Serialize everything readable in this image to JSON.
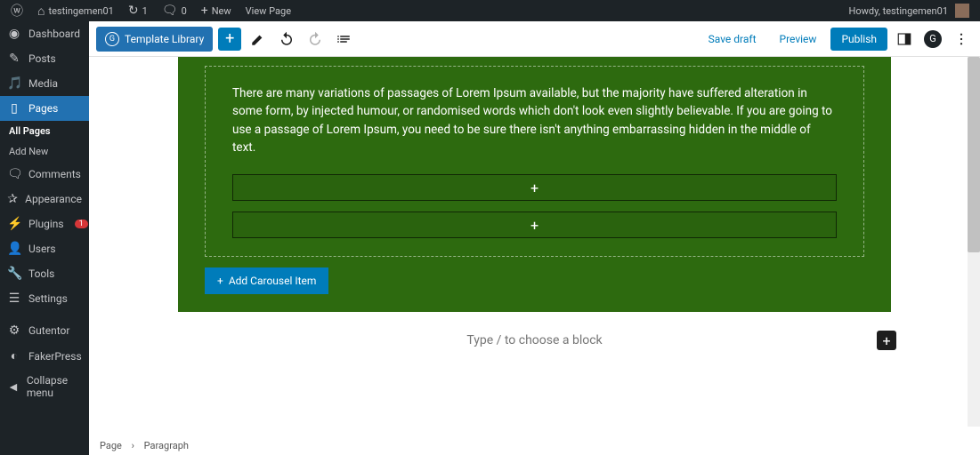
{
  "adminbar": {
    "site_name": "testingemen01",
    "refresh_count": "1",
    "comments_count": "0",
    "new_label": "New",
    "view_page": "View Page",
    "howdy": "Howdy, testingemen01"
  },
  "sidebar": {
    "items": [
      {
        "icon": "dash",
        "label": "Dashboard"
      },
      {
        "icon": "pin",
        "label": "Posts"
      },
      {
        "icon": "media",
        "label": "Media"
      },
      {
        "icon": "page",
        "label": "Pages",
        "current": true
      },
      {
        "icon": "comment",
        "label": "Comments"
      },
      {
        "icon": "brush",
        "label": "Appearance"
      },
      {
        "icon": "plug",
        "label": "Plugins",
        "badge": "1"
      },
      {
        "icon": "user",
        "label": "Users"
      },
      {
        "icon": "tool",
        "label": "Tools"
      },
      {
        "icon": "gear",
        "label": "Settings"
      },
      {
        "icon": "g",
        "label": "Gutentor"
      },
      {
        "icon": "fp",
        "label": "FakerPress"
      },
      {
        "icon": "collapse",
        "label": "Collapse menu"
      }
    ],
    "submenu": {
      "all_pages": "All Pages",
      "add_new": "Add New"
    }
  },
  "toolbar": {
    "template_library": "Template Library",
    "save_draft": "Save draft",
    "preview": "Preview",
    "publish": "Publish"
  },
  "content": {
    "lorem": "There are many variations of passages of Lorem Ipsum available, but the majority have suffered alteration in some form, by injected humour, or randomised words which don't look even slightly believable. If you are going to use a passage of Lorem Ipsum, you need to be sure there isn't anything embarrassing hidden in the middle of text.",
    "add_carousel": "Add Carousel Item",
    "placeholder": "Type / to choose a block"
  },
  "breadcrumb": {
    "root": "Page",
    "current": "Paragraph"
  },
  "colors": {
    "accent": "#007cba",
    "green": "#2d6a0f",
    "adminbar": "#1d2327"
  }
}
